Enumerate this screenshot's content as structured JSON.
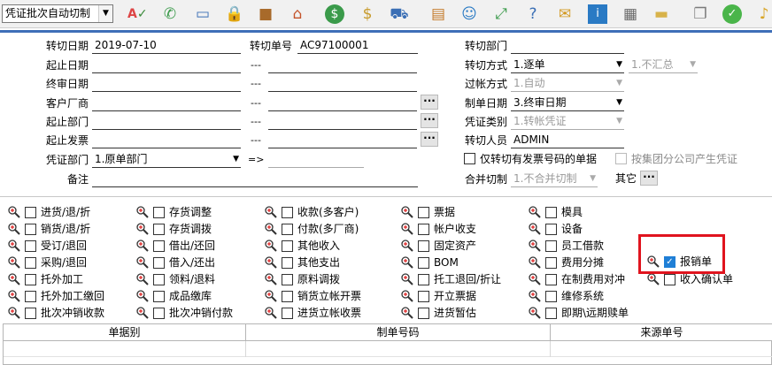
{
  "toolbar": {
    "mode_value": "凭证批次自动切制",
    "icons": [
      "spell-check-icon",
      "phone-icon",
      "computer-icon",
      "lock-icon",
      "briefcase-icon",
      "house-icon",
      "dollar-icon",
      "money-bag-icon",
      "cart-icon",
      "clipboard-icon",
      "users-icon",
      "zoom-icon",
      "help-doc-icon",
      "mail-icon",
      "info-icon",
      "calculator-icon",
      "folder-icon",
      "copy-icon",
      "ok-icon",
      "bell-icon"
    ]
  },
  "form": {
    "transfer_date_label": "转切日期",
    "transfer_date_value": "2019-07-10",
    "transfer_no_label": "转切单号",
    "transfer_no_value": "AC97100001",
    "transfer_dept_label": "转切部门",
    "start_date_label": "起止日期",
    "final_review_date_label": "终审日期",
    "customer_vendor_label": "客户厂商",
    "start_dept_label": "起止部门",
    "start_invoice_label": "起止发票",
    "voucher_dept_label": "凭证部门",
    "voucher_dept_value": "1.原单部门",
    "arrow_text": "=>",
    "note_label": "备注",
    "dash": "---",
    "transfer_mode_label": "转切方式",
    "transfer_mode_value": "1.逐单",
    "summary_value": "1.不汇总",
    "posting_mode_label": "过帐方式",
    "posting_mode_value": "1.自动",
    "voucher_date_label": "制单日期",
    "voucher_date_value": "3.终审日期",
    "voucher_type_label": "凭证类别",
    "voucher_type_value": "1.转帐凭证",
    "transfer_person_label": "转切人员",
    "transfer_person_value": "ADMIN",
    "only_invoice_label": "仅转切有发票号码的单据",
    "group_company_label": "按集团分公司产生凭证",
    "merge_label": "合并切制",
    "merge_value": "1.不合并切制",
    "other_label": "其它",
    "ellipsis": "···"
  },
  "options": {
    "col1": [
      "进货/退/折",
      "销货/退/折",
      "受订/退回",
      "采购/退回",
      "托外加工",
      "托外加工缴回",
      "批次冲销收款"
    ],
    "col2": [
      "存货调整",
      "存货调拨",
      "借出/还回",
      "借入/还出",
      "领料/退料",
      "成品缴库",
      "批次冲销付款"
    ],
    "col3": [
      "收款(多客户)",
      "付款(多厂商)",
      "其他收入",
      "其他支出",
      "原料调拨",
      "销货立帐开票",
      "进货立帐收票"
    ],
    "col4": [
      "票据",
      "帐户收支",
      "固定资产",
      "BOM",
      "托工退回/折让",
      "开立票据",
      "进货暂估"
    ],
    "col5": [
      "模具",
      "设备",
      "员工借款",
      "费用分摊",
      "在制费用对冲",
      "维修系统",
      "即期\\远期赎单"
    ],
    "col6": [
      "报销单",
      "收入确认单"
    ],
    "checked_item": "报销单"
  },
  "grid": {
    "headers": [
      "单据别",
      "制单号码",
      "来源单号"
    ]
  },
  "colors": {
    "accent_bar": "#3f6fb8",
    "highlight": "#e0141e",
    "check": "#1f7fd6"
  }
}
